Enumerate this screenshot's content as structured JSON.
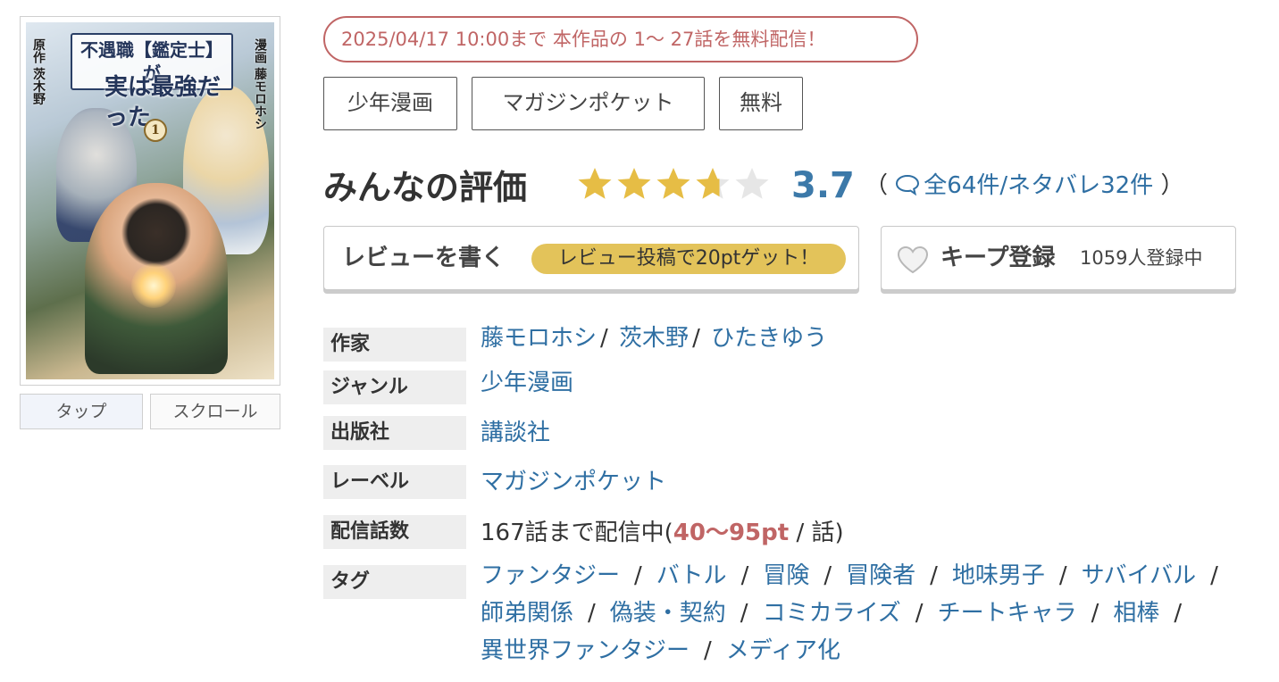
{
  "cover": {
    "title_line1": "不遇職【鑑定士】が",
    "title_line2": "実は最強だった",
    "credit_left": "原作 茨木野",
    "credit_right": "漫画 藤モロホシ",
    "volume": "1",
    "tabs": {
      "tap": "タップ",
      "scroll": "スクロール"
    }
  },
  "free_banner": "2025/04/17 10:00まで 本作品の 1〜 27話を無料配信！",
  "category_tags": [
    "少年漫画",
    "マガジンポケット",
    "無料"
  ],
  "rating": {
    "title": "みんなの評価",
    "value": "3.7",
    "stars": 3.7,
    "open_paren": "（",
    "summary": "全64件/ネタバレ32件",
    "close_paren": "）",
    "colors": {
      "star_filled": "#e6bd45",
      "star_empty": "#e6e6e6",
      "value": "#3c79a9"
    }
  },
  "actions": {
    "review_label": "レビューを書く",
    "review_promo": "レビュー投稿で20ptゲット！",
    "keep_label": "キープ登録",
    "keep_count": "1059人登録中"
  },
  "info": {
    "author": {
      "label": "作家",
      "values": [
        "藤モロホシ",
        "茨木野",
        "ひたきゆう"
      ]
    },
    "genre": {
      "label": "ジャンル",
      "value": "少年漫画"
    },
    "publisher": {
      "label": "出版社",
      "value": "講談社"
    },
    "label": {
      "label": "レーベル",
      "value": "マガジンポケット"
    },
    "episodes": {
      "label": "配信話数",
      "prefix": "167話まで配信中(",
      "price": "40〜95pt",
      "suffix": " / 話)"
    },
    "tags": {
      "label": "タグ",
      "lines": [
        [
          "ファンタジー",
          "バトル",
          "冒険",
          "冒険者",
          "地味男子",
          "サバイバル"
        ],
        [
          "師弟関係",
          "偽装・契約",
          "コミカライズ",
          "チートキャラ",
          "相棒"
        ],
        [
          "異世界ファンタジー",
          "メディア化"
        ]
      ]
    }
  },
  "colors": {
    "link": "#2f6fa3",
    "accent_red": "#c06565",
    "promo_pill": "#e3c35a"
  }
}
